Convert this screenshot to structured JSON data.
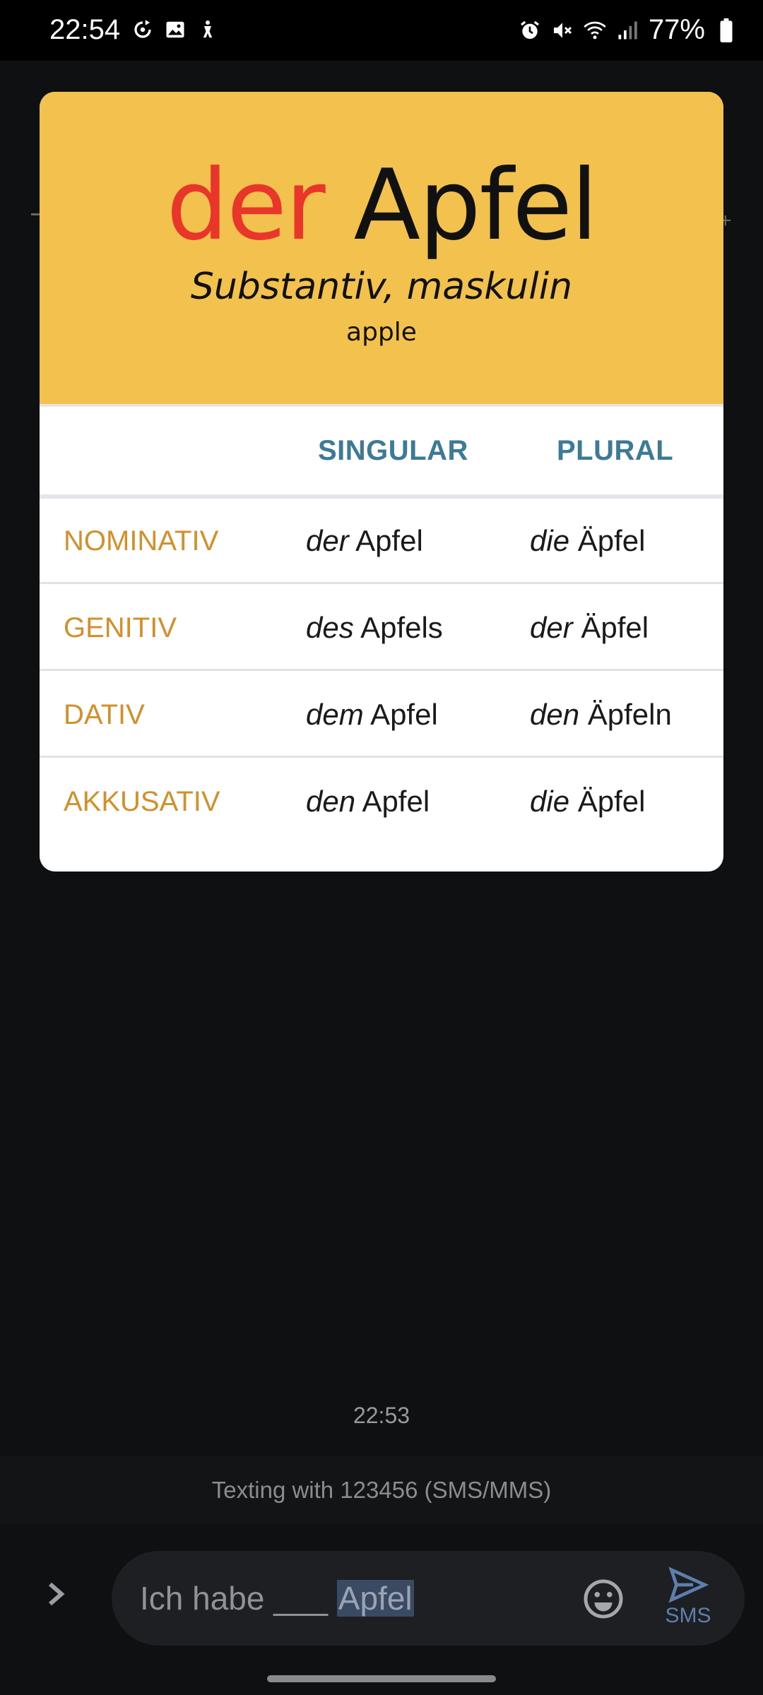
{
  "status_bar": {
    "time": "22:54",
    "battery": "77%",
    "left_icons": [
      "sync-icon",
      "image-icon",
      "accessibility-icon"
    ],
    "right_icons": [
      "alarm-icon",
      "mute-icon",
      "wifi-icon",
      "signal-icon",
      "battery-icon"
    ]
  },
  "card": {
    "article": "der",
    "noun": "Apfel",
    "part_of_speech": "Substantiv, maskulin",
    "translation": "apple",
    "columns": {
      "singular": "SINGULAR",
      "plural": "PLURAL"
    },
    "rows": [
      {
        "case": "NOMINATIV",
        "sing_art": "der",
        "sing_noun": "Apfel",
        "plur_art": "die",
        "plur_noun": "Äpfel"
      },
      {
        "case": "GENITIV",
        "sing_art": "des",
        "sing_noun": "Apfels",
        "plur_art": "der",
        "plur_noun": "Äpfel"
      },
      {
        "case": "DATIV",
        "sing_art": "dem",
        "sing_noun": "Apfel",
        "plur_art": "den",
        "plur_noun": "Äpfeln"
      },
      {
        "case": "AKKUSATIV",
        "sing_art": "den",
        "sing_noun": "Apfel",
        "plur_art": "die",
        "plur_noun": "Äpfel"
      }
    ],
    "colors": {
      "header_bg": "#f2c14e",
      "article": "#e8372a",
      "column_header": "#3d7a96",
      "case_label": "#d28f2a"
    }
  },
  "conversation": {
    "timestamp": "22:53",
    "banner": "Texting with 123456 (SMS/MMS)"
  },
  "compose": {
    "text_before": "Ich habe ___ ",
    "text_selected": "Apfel",
    "send_label": "SMS"
  }
}
